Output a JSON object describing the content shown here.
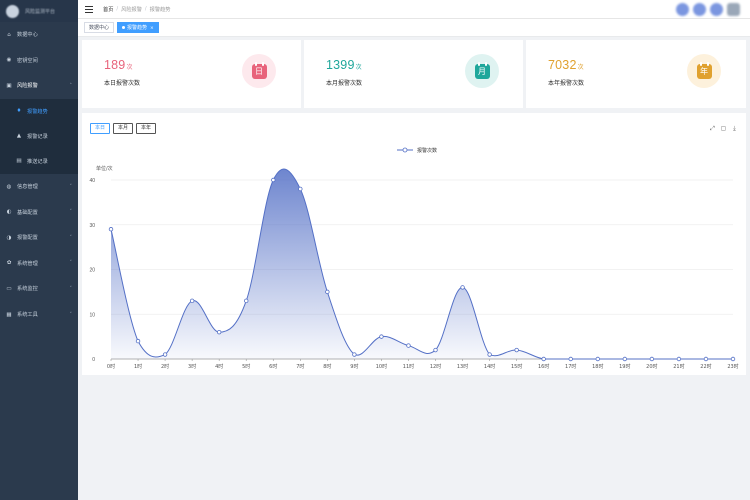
{
  "sidebar": {
    "brand": "风险监测平台",
    "items": [
      {
        "label": "数据中心",
        "icon": "home-icon"
      },
      {
        "label": "密钥空间",
        "icon": "location-icon"
      },
      {
        "label": "风险报警",
        "icon": "alarm-icon"
      },
      {
        "label": "信息管理",
        "icon": "info-icon"
      },
      {
        "label": "基础配置",
        "icon": "settings-icon"
      },
      {
        "label": "报警配置",
        "icon": "settings-icon"
      },
      {
        "label": "系统管理",
        "icon": "gear-icon"
      },
      {
        "label": "系统监控",
        "icon": "monitor-icon"
      },
      {
        "label": "系统工具",
        "icon": "tools-icon"
      }
    ],
    "sub_items": [
      {
        "label": "报警趋势",
        "icon": "trend-icon"
      },
      {
        "label": "报警记录",
        "icon": "record-icon"
      },
      {
        "label": "推送记录",
        "icon": "push-icon"
      }
    ]
  },
  "breadcrumb": [
    "首页",
    "风险报警",
    "报警趋势"
  ],
  "tags": [
    "数据中心",
    "报警趋势"
  ],
  "cards": [
    {
      "value": "189",
      "unit": "次",
      "label": "本日报警次数",
      "icon_text": "日",
      "color": "#e8637b",
      "bg": "#fde9ed"
    },
    {
      "value": "1399",
      "unit": "次",
      "label": "本月报警次数",
      "icon_text": "月",
      "color": "#1fa79b",
      "bg": "#dff3f1"
    },
    {
      "value": "7032",
      "unit": "次",
      "label": "本年报警次数",
      "icon_text": "年",
      "color": "#e0a12f",
      "bg": "#fdf1dc"
    }
  ],
  "range_buttons": [
    "本日",
    "本月",
    "本年"
  ],
  "chart_data": {
    "type": "area",
    "legend": "报警次数",
    "ylabel": "单位/次",
    "ylim": [
      0,
      40
    ],
    "yticks": [
      0,
      10,
      20,
      30,
      40
    ],
    "categories": [
      "0时",
      "1时",
      "2时",
      "3时",
      "4时",
      "5时",
      "6时",
      "7时",
      "8时",
      "9时",
      "10时",
      "11时",
      "12时",
      "13时",
      "14时",
      "15时",
      "16时",
      "17时",
      "18时",
      "19时",
      "20时",
      "21时",
      "22时",
      "23时"
    ],
    "series": [
      {
        "name": "报警次数",
        "values": [
          29,
          4,
          1,
          13,
          6,
          13,
          40,
          38,
          15,
          1,
          5,
          3,
          2,
          16,
          1,
          2,
          0,
          0,
          0,
          0,
          0,
          0,
          0,
          0
        ]
      }
    ],
    "color": "#5470c6"
  }
}
